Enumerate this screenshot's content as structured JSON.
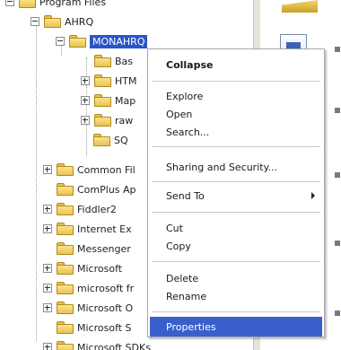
{
  "tree": {
    "items": [
      {
        "label": "Program Files",
        "expander": "minus"
      },
      {
        "label": "AHRQ",
        "expander": "minus"
      },
      {
        "label": "MONAHRQ",
        "expander": "minus",
        "selected": true
      },
      {
        "label": "Bas",
        "expander": "none"
      },
      {
        "label": "HTM",
        "expander": "plus"
      },
      {
        "label": "Map",
        "expander": "plus"
      },
      {
        "label": "raw",
        "expander": "plus"
      },
      {
        "label": "SQ",
        "expander": "none"
      },
      {
        "label": "Common Fil",
        "expander": "plus"
      },
      {
        "label": "ComPlus Ap",
        "expander": "none"
      },
      {
        "label": "Fiddler2",
        "expander": "plus"
      },
      {
        "label": "Internet Ex",
        "expander": "plus"
      },
      {
        "label": "Messenger",
        "expander": "none"
      },
      {
        "label": "Microsoft",
        "expander": "plus"
      },
      {
        "label": "microsoft fr",
        "expander": "plus"
      },
      {
        "label": "Microsoft O",
        "expander": "plus"
      },
      {
        "label": "Microsoft S",
        "expander": "none"
      },
      {
        "label": "Microsoft SDKs",
        "expander": "plus"
      }
    ]
  },
  "context_menu": {
    "items": [
      {
        "label": "Collapse",
        "bold": true
      },
      {
        "label": "Explore"
      },
      {
        "label": "Open"
      },
      {
        "label": "Search..."
      },
      {
        "label": "Sharing and Security..."
      },
      {
        "label": "Send To",
        "has_submenu": true
      },
      {
        "label": "Cut"
      },
      {
        "label": "Copy"
      },
      {
        "label": "Delete"
      },
      {
        "label": "Rename"
      },
      {
        "label": "Properties",
        "highlighted": true
      }
    ]
  },
  "colors": {
    "selection": "#2a55c9",
    "menu_highlight": "#3a5fcd",
    "folder": "#e9c254"
  }
}
